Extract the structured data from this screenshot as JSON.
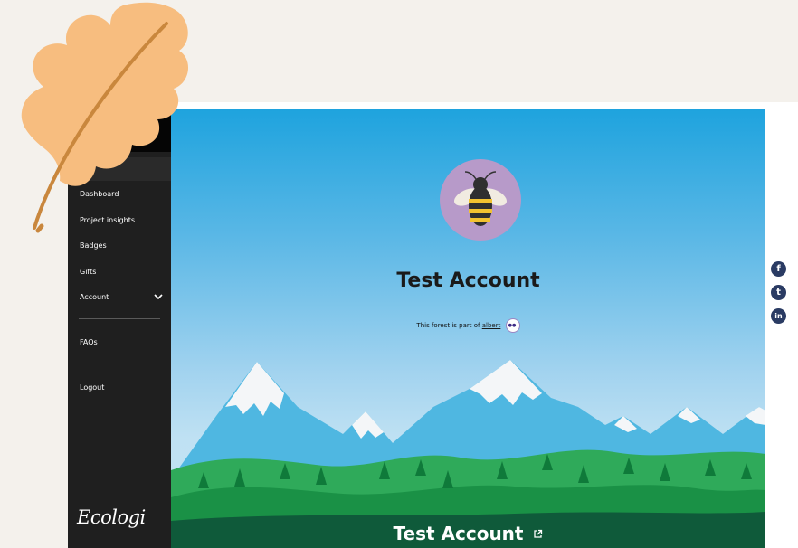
{
  "sidebar": {
    "items": [
      {
        "label": "Dashboard"
      },
      {
        "label": "Project insights"
      },
      {
        "label": "Badges"
      },
      {
        "label": "Gifts"
      },
      {
        "label": "Account"
      },
      {
        "label": "FAQs"
      },
      {
        "label": "Logout"
      }
    ],
    "logo_text": "Ecologi"
  },
  "profile": {
    "name": "Test Account",
    "forest_prefix": "This forest is part of",
    "forest_link": "albert",
    "footer_name": "Test Account"
  },
  "share": [
    {
      "icon": "facebook-icon",
      "glyph": "f"
    },
    {
      "icon": "twitter-icon",
      "glyph": "t"
    },
    {
      "icon": "linkedin-icon",
      "glyph": "in"
    }
  ],
  "colors": {
    "sidebar_bg": "#1f1f1f",
    "active_accent": "#1dbf73",
    "sky_top": "#1ea3de",
    "avatar_bg": "#b79ac9",
    "share_icon_bg": "#2a3b63",
    "leaf": "#f7bd7f"
  }
}
